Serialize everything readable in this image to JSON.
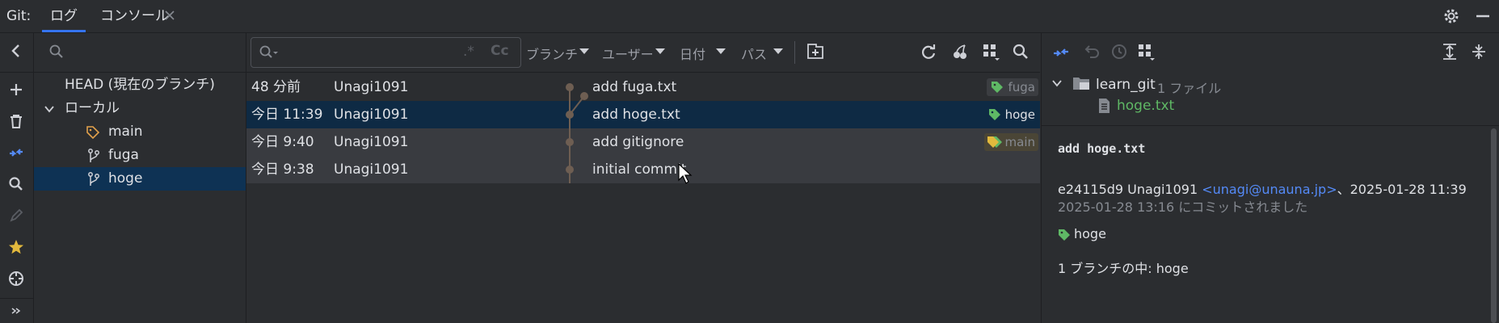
{
  "tabbar": {
    "prefix": "Git:",
    "tabs": [
      {
        "label": "ログ",
        "active": true
      },
      {
        "label": "コンソール",
        "active": false
      }
    ]
  },
  "left_toolbar": {
    "icons": [
      "collapse-left-icon",
      "add-icon",
      "trash-icon",
      "fetch-icon",
      "search-icon",
      "edit-icon",
      "star-icon",
      "target-icon",
      "expand-more-icon"
    ]
  },
  "branches": {
    "head": "HEAD (現在のブランチ)",
    "local_label": "ローカル",
    "items": [
      {
        "name": "main",
        "icon": "tag-icon",
        "selected": false
      },
      {
        "name": "fuga",
        "icon": "branch-icon",
        "selected": false
      },
      {
        "name": "hoge",
        "icon": "branch-icon",
        "selected": true
      }
    ]
  },
  "filters": {
    "search_placeholder": "",
    "regex_label": ".*",
    "case_label": "Cc",
    "branch": "ブランチ",
    "user": "ユーザー",
    "date": "日付",
    "path": "パス"
  },
  "commits": [
    {
      "time": "48 分前",
      "author": "Unagi1091",
      "message": "add fuga.txt",
      "tag": "fuga",
      "tag_color": "#5fb865",
      "state": "normal"
    },
    {
      "time": "今日 11:39",
      "author": "Unagi1091",
      "message": "add hoge.txt",
      "tag": "hoge",
      "tag_color": "#5fb865",
      "state": "selected"
    },
    {
      "time": "今日 9:40",
      "author": "Unagi1091",
      "message": "add gitignore",
      "tag": "main",
      "tag_color": "#e2b93d",
      "state": "highlight"
    },
    {
      "time": "今日 9:38",
      "author": "Unagi1091",
      "message": "initial commit",
      "tag": "",
      "tag_color": "",
      "state": "highlight"
    }
  ],
  "changes": {
    "repo": "learn_git",
    "count": "1 ファイル",
    "file": "hoge.txt"
  },
  "details": {
    "subject": "add hoge.txt",
    "hash_author": "e24115d9 Unagi1091",
    "email": "<unagi@unauna.jp>",
    "authored_suffix": "、2025-01-28 11:39",
    "committed": "2025-01-28 13:16 にコミットされました",
    "tag": "hoge",
    "contained_in": "1 ブランチの中: hoge"
  },
  "colors": {
    "accent": "#3574f0",
    "selection": "#0e3254",
    "tag_green": "#5fb865",
    "tag_yellow": "#e2b93d",
    "link": "#548af7"
  }
}
